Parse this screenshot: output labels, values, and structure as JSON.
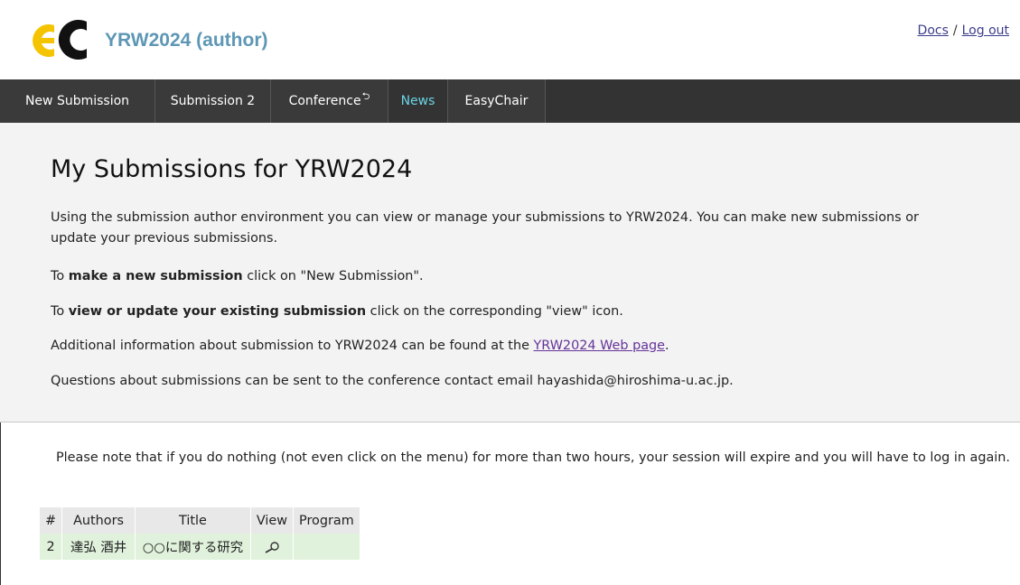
{
  "header": {
    "title": "YRW2024 (author)",
    "links": {
      "docs": "Docs",
      "separator": "/",
      "logout": "Log out"
    }
  },
  "nav": {
    "items": [
      {
        "label": "New Submission"
      },
      {
        "label": "Submission 2"
      },
      {
        "label": "Conference",
        "icon": "return-arrow-icon"
      },
      {
        "label": "News",
        "active": true
      },
      {
        "label": "EasyChair"
      }
    ]
  },
  "main": {
    "heading": "My Submissions for YRW2024",
    "intro": "Using the submission author environment you can view or manage your submissions to YRW2024. You can make new submissions or update your previous submissions.",
    "make_new": {
      "pre": "To ",
      "bold": "make a new submission",
      "post": " click on \"New Submission\"."
    },
    "view_update": {
      "pre": "To ",
      "bold": "view or update your existing submission",
      "post": " click on the corresponding \"view\" icon."
    },
    "additional": {
      "pre": "Additional information about submission to YRW2024 can be found at the ",
      "link": "YRW2024 Web page",
      "post": "."
    },
    "questions": "Questions about submissions can be sent to the conference contact email hayashida@hiroshima-u.ac.jp.",
    "session_note": "Please note that if you do nothing (not even click on the menu) for more than two hours, your session will expire and you will have to log in again."
  },
  "table": {
    "columns": [
      "#",
      "Authors",
      "Title",
      "View",
      "Program"
    ],
    "rows": [
      {
        "num": "2",
        "authors": "達弘 酒井",
        "title": "○○に関する研究",
        "view_icon": "magnifier-icon",
        "program": ""
      }
    ]
  },
  "colors": {
    "title": "#5e97b5",
    "navbar": "#333333",
    "nav_active": "#6ad4e6",
    "row": "#e0f2dc",
    "header_row": "#e8e8e8"
  }
}
